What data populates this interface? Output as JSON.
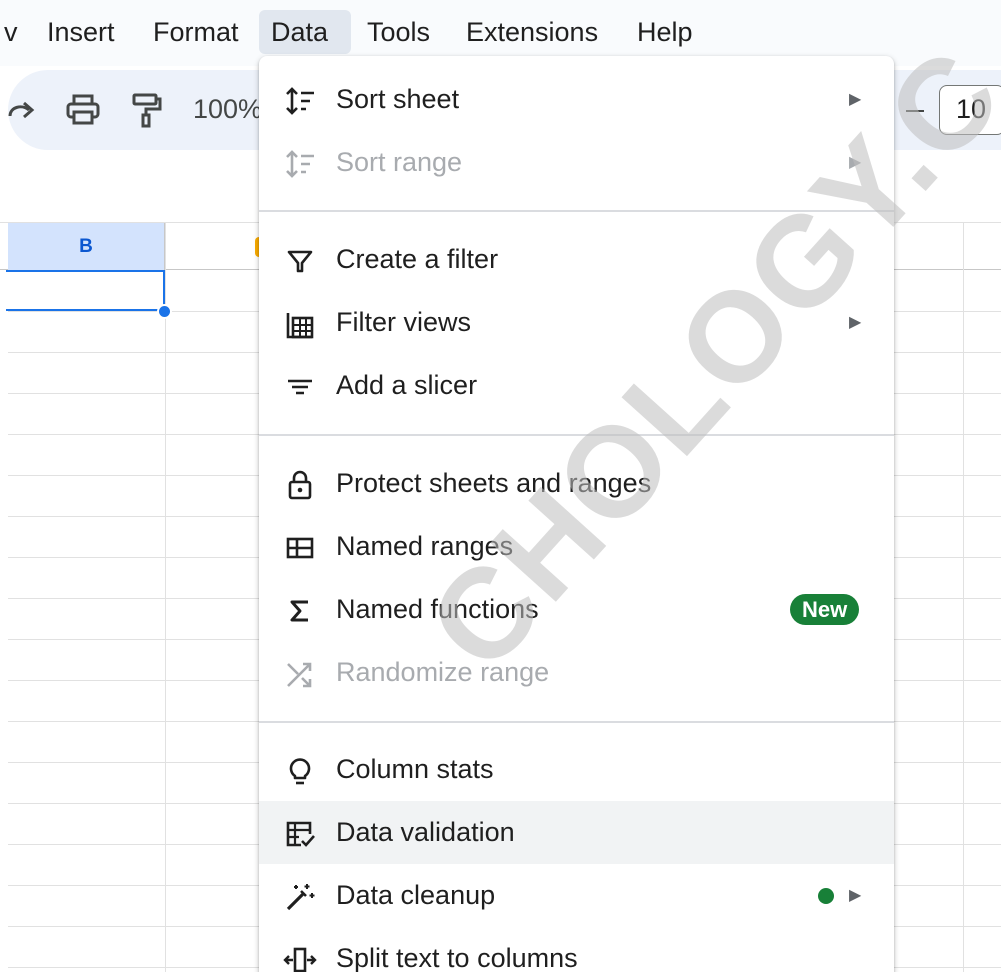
{
  "menubar": {
    "items": [
      "v",
      "Insert",
      "Format",
      "Data",
      "Tools",
      "Extensions",
      "Help"
    ],
    "active": "Data"
  },
  "toolbar": {
    "icons": [
      "redo-icon",
      "print-icon",
      "paint-format-icon"
    ],
    "zoom": "100%",
    "font_size": "10"
  },
  "sheet": {
    "column_header_selected": "B"
  },
  "data_menu": {
    "items": [
      {
        "label": "Sort sheet",
        "icon": "sort-icon",
        "submenu": true,
        "disabled": false
      },
      {
        "label": "Sort range",
        "icon": "sort-range-icon",
        "submenu": true,
        "disabled": true
      },
      {
        "label": "Create a filter",
        "icon": "filter-icon",
        "submenu": false,
        "disabled": false
      },
      {
        "label": "Filter views",
        "icon": "filter-views-icon",
        "submenu": true,
        "disabled": false
      },
      {
        "label": "Add a slicer",
        "icon": "slicer-icon",
        "submenu": false,
        "disabled": false
      },
      {
        "label": "Protect sheets and ranges",
        "icon": "lock-icon",
        "submenu": false,
        "disabled": false
      },
      {
        "label": "Named ranges",
        "icon": "named-ranges-icon",
        "submenu": false,
        "disabled": false
      },
      {
        "label": "Named functions",
        "icon": "sigma-icon",
        "submenu": false,
        "disabled": false,
        "badge": "New"
      },
      {
        "label": "Randomize range",
        "icon": "shuffle-icon",
        "submenu": false,
        "disabled": true
      },
      {
        "label": "Column stats",
        "icon": "lightbulb-icon",
        "submenu": false,
        "disabled": false
      },
      {
        "label": "Data validation",
        "icon": "data-validation-icon",
        "submenu": false,
        "disabled": false,
        "hovered": true
      },
      {
        "label": "Data cleanup",
        "icon": "magic-wand-icon",
        "submenu": true,
        "disabled": false,
        "indicator": "green-dot"
      },
      {
        "label": "Split text to columns",
        "icon": "split-columns-icon",
        "submenu": false,
        "disabled": false
      }
    ]
  },
  "watermark": "CHOLOGY.C",
  "colors": {
    "accent": "#1a73e8",
    "badge_green": "#188038",
    "menubar_active": "#e1e7ef",
    "toolbar_bg": "#edf2fa",
    "disabled_text": "#a8abaf"
  }
}
